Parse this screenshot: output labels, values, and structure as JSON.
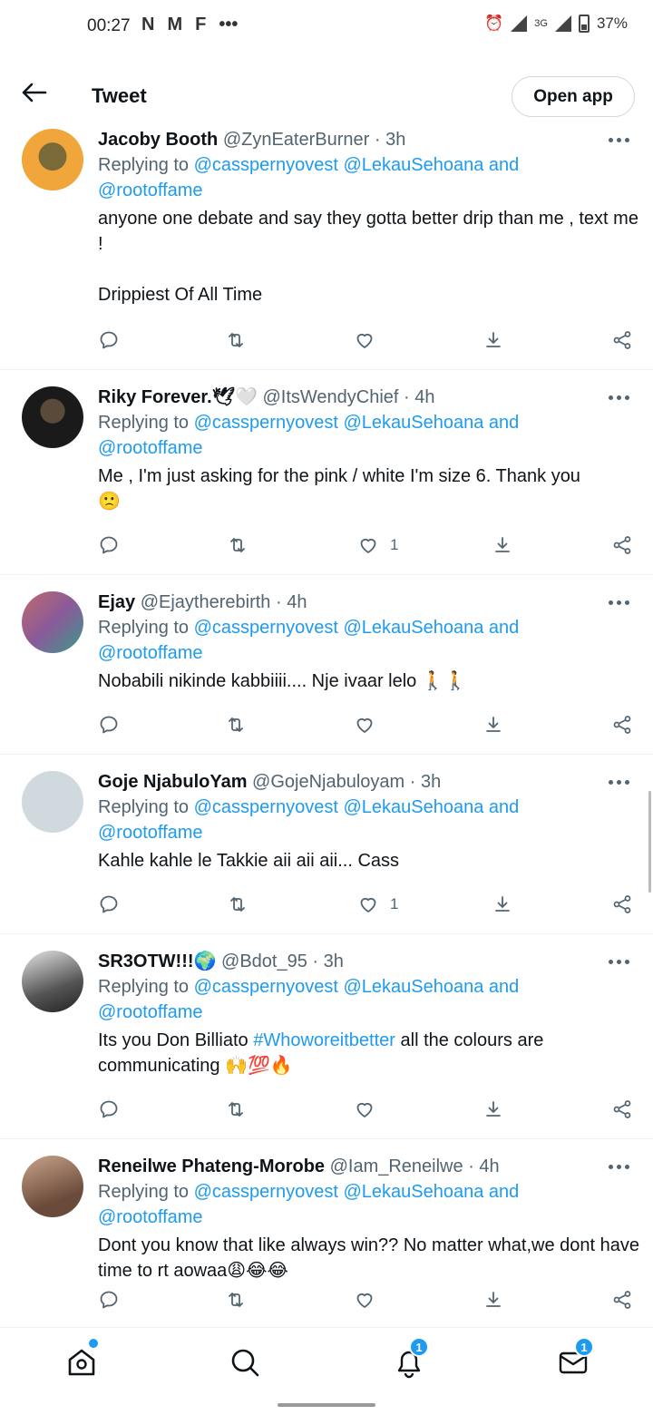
{
  "status_bar": {
    "time": "00:27",
    "signal_label": "3G",
    "battery": "37%"
  },
  "header": {
    "title": "Tweet",
    "open_app_label": "Open app"
  },
  "tweets": [
    {
      "name": "Jacoby Booth",
      "handle": "@ZynEaterBurner",
      "time": "3h",
      "replying_prefix": "Replying to",
      "mention1": "@casspernyovest",
      "mention2": "@LekauSehoana",
      "and": "and",
      "mention3": "@rootoffame",
      "text": "anyone one debate and say they gotta better drip than me , text me !\n\nDrippiest Of All Time",
      "likes": ""
    },
    {
      "name": "Riky Forever.🕊🤍",
      "handle": "@ItsWendyChief",
      "time": "4h",
      "replying_prefix": "Replying to",
      "mention1": "@casspernyovest",
      "mention2": "@LekauSehoana",
      "and": "and",
      "mention3": "@rootoffame",
      "text": "Me , I'm just asking for the pink / white I'm size 6. Thank you\n🙁",
      "likes": "1"
    },
    {
      "name": "Ejay",
      "handle": "@Ejaytherebirth",
      "time": "4h",
      "replying_prefix": "Replying to",
      "mention1": "@casspernyovest",
      "mention2": "@LekauSehoana",
      "and": "and",
      "mention3": "@rootoffame",
      "text": "Nobabili nikinde kabbiiii.... Nje ivaar lelo 🚶🚶",
      "likes": ""
    },
    {
      "name": "Goje NjabuloYam",
      "handle": "@GojeNjabuloyam",
      "time": "3h",
      "replying_prefix": "Replying to",
      "mention1": "@casspernyovest",
      "mention2": "@LekauSehoana",
      "and": "and",
      "mention3": "@rootoffame",
      "text": "Kahle kahle le Takkie aii aii aii... Cass",
      "likes": "1"
    },
    {
      "name": "SR3OTW!!!🌍",
      "handle": "@Bdot_95",
      "time": "3h",
      "replying_prefix": "Replying to",
      "mention1": "@casspernyovest",
      "mention2": "@LekauSehoana",
      "and": "and",
      "mention3": "@rootoffame",
      "text_before": "Its you Don Billiato ",
      "hashtag": "#Whoworeitbetter",
      "text_after": " all the colours are communicating 🙌💯🔥",
      "likes": ""
    },
    {
      "name": "Reneilwe Phateng-Morobe",
      "handle": "@Iam_Reneilwe",
      "time": "4h",
      "replying_prefix": "Replying to",
      "mention1": "@casspernyovest",
      "mention2": "@LekauSehoana",
      "and": "and",
      "mention3": "@rootoffame",
      "text": "Dont you know that like always win?? No matter what,we dont have time to rt aowaa😩😂😂",
      "likes": ""
    }
  ],
  "bottom_nav": {
    "notifications_badge": "1",
    "messages_badge": "1"
  },
  "icons": [
    "back-arrow-icon",
    "more-icon",
    "reply-icon",
    "retweet-icon",
    "like-icon",
    "download-icon",
    "share-icon",
    "home-icon",
    "search-icon",
    "bell-icon",
    "mail-icon"
  ],
  "colors": {
    "accent": "#1d9bf0",
    "muted": "#536471",
    "text": "#0f1419"
  }
}
